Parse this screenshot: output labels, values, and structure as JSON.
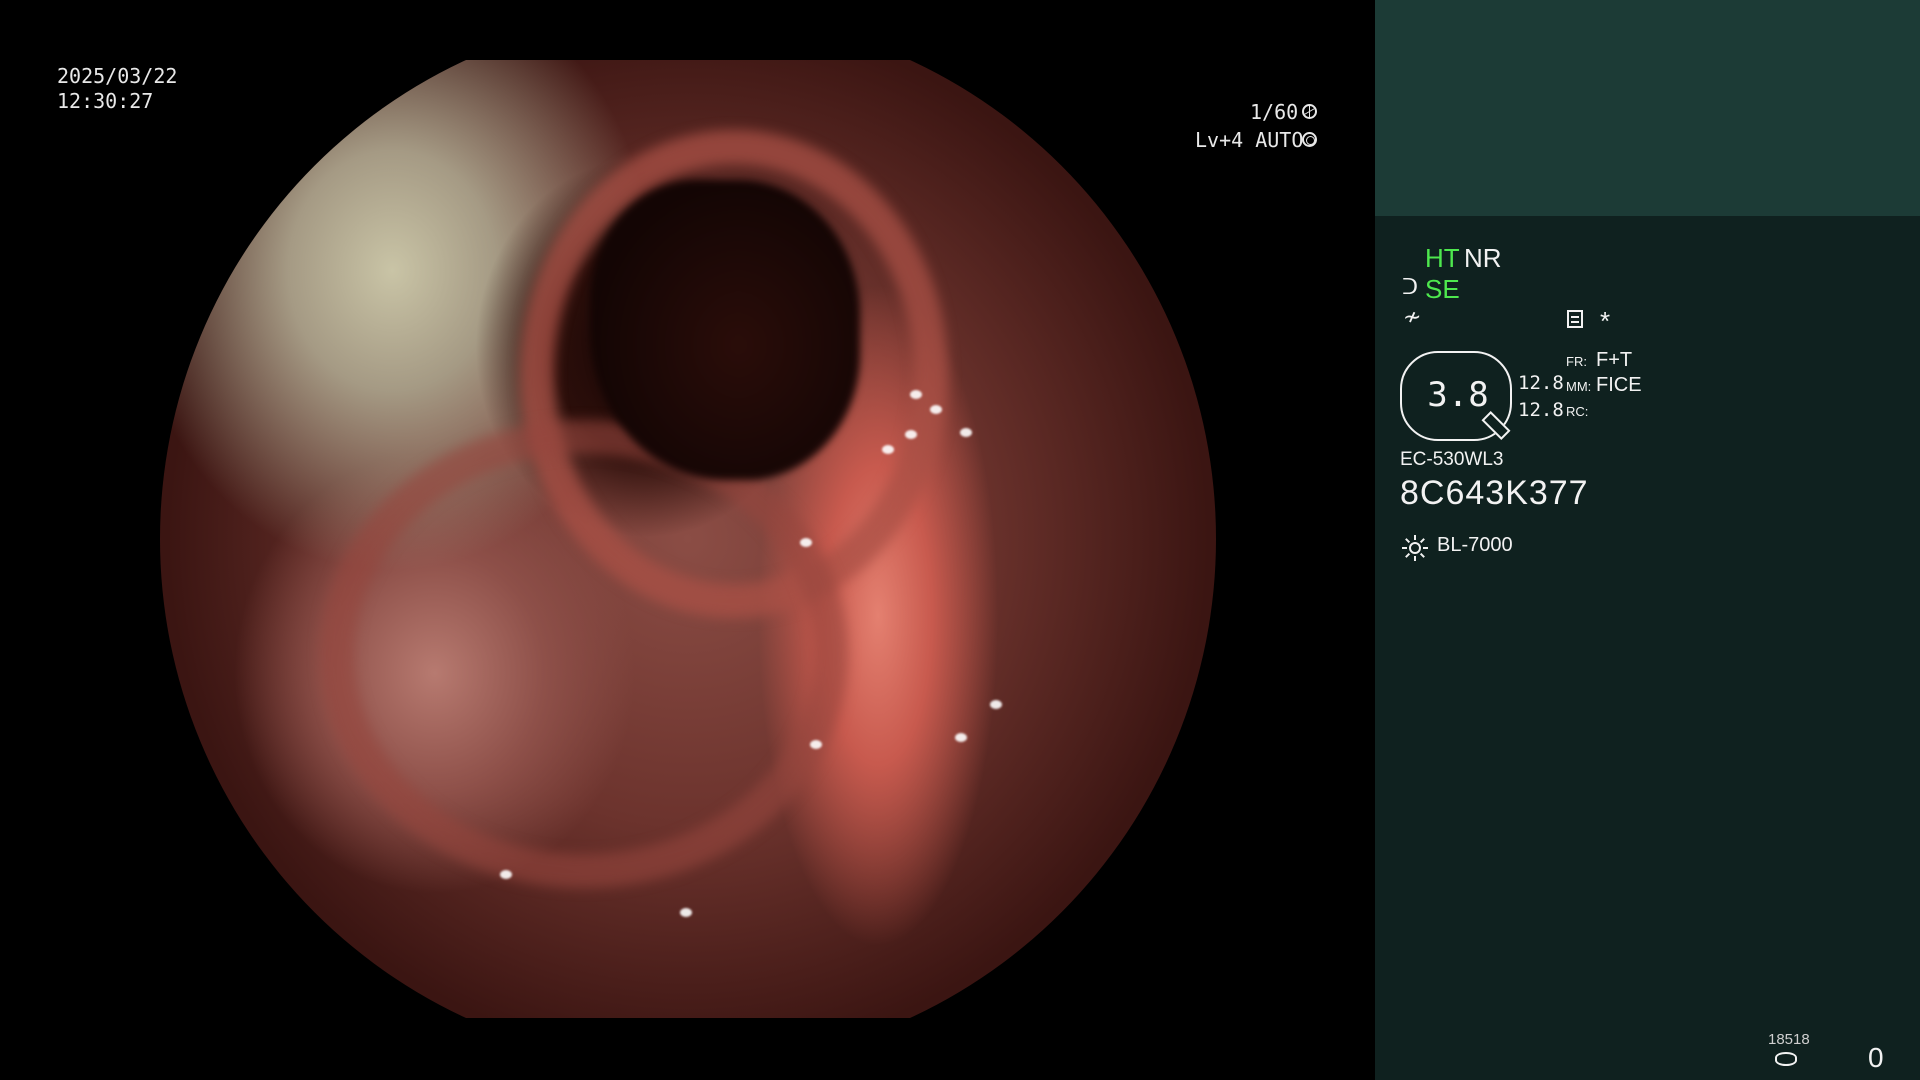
{
  "overlay": {
    "date": "2025/03/22",
    "time": "12:30:27",
    "shutter_speed": "1/60",
    "exposure": "Lv+4 AUTO"
  },
  "panel": {
    "ht_label": "HT",
    "nr_label": "NR",
    "se_label": "SE",
    "se_icon": "ᑐ",
    "edge_icon": "≁",
    "asterisk": "*",
    "brightness_value": "3.8",
    "values": {
      "top": "12.8",
      "bottom": "12.8"
    },
    "settings": {
      "fr_key": "FR:",
      "fr_value": "F+T",
      "mm_key": "MM:",
      "mm_value": "FICE",
      "rc_key": "RC:"
    },
    "scope_model": "EC-530WL3",
    "scope_serial": "8C643K377",
    "lamp_model": "BL-7000",
    "storage_count": "18518",
    "capture_count": "0"
  },
  "colors": {
    "panel_background": "#0f211f",
    "panel_header": "#1c3b36",
    "active_green": "#4ee84e",
    "text": "#f2f2f2"
  },
  "icons": [
    "shutter-icon",
    "iris-icon",
    "structure-enhance-icon",
    "edge-icon",
    "memo-icon",
    "brightness-gauge",
    "lamp-icon",
    "storage-icon"
  ]
}
